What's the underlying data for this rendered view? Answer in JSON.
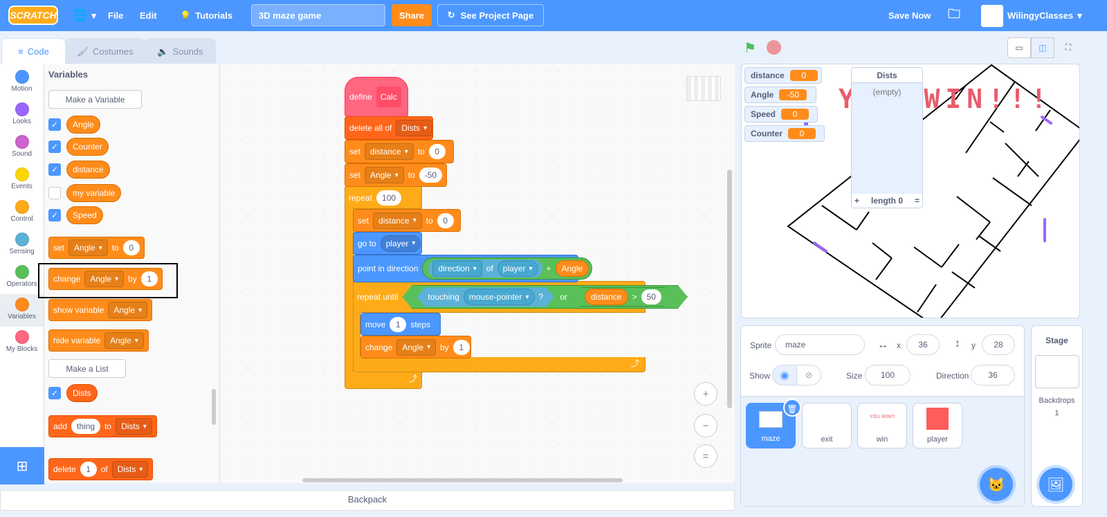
{
  "menubar": {
    "logo": "SCRATCH",
    "file": "File",
    "edit": "Edit",
    "tutorials": "Tutorials",
    "project_title": "3D maze game",
    "share": "Share",
    "see_project": "See Project Page",
    "save_now": "Save Now",
    "username": "WilingyClasses"
  },
  "tabs": {
    "code": "Code",
    "costumes": "Costumes",
    "sounds": "Sounds"
  },
  "categories": [
    {
      "label": "Motion",
      "color": "#4c97ff"
    },
    {
      "label": "Looks",
      "color": "#9966ff"
    },
    {
      "label": "Sound",
      "color": "#cf63cf"
    },
    {
      "label": "Events",
      "color": "#ffd500"
    },
    {
      "label": "Control",
      "color": "#ffab19"
    },
    {
      "label": "Sensing",
      "color": "#5cb1d6"
    },
    {
      "label": "Operators",
      "color": "#59c059"
    },
    {
      "label": "Variables",
      "color": "#ff8c1a"
    },
    {
      "label": "My Blocks",
      "color": "#ff6680"
    }
  ],
  "palette": {
    "heading": "Variables",
    "make_variable": "Make a Variable",
    "variables": [
      {
        "name": "Angle",
        "checked": true
      },
      {
        "name": "Counter",
        "checked": true
      },
      {
        "name": "distance",
        "checked": true
      },
      {
        "name": "my variable",
        "checked": false
      },
      {
        "name": "Speed",
        "checked": true
      }
    ],
    "set_block": {
      "w1": "set",
      "var": "Angle",
      "w2": "to",
      "val": "0"
    },
    "change_block": {
      "w1": "change",
      "var": "Angle",
      "w2": "by",
      "val": "1"
    },
    "show_block": {
      "w1": "show variable",
      "var": "Angle"
    },
    "hide_block": {
      "w1": "hide variable",
      "var": "Angle"
    },
    "make_list": "Make a List",
    "list": {
      "name": "Dists",
      "checked": true
    },
    "add_block": {
      "w1": "add",
      "val": "thing",
      "w2": "to",
      "list": "Dists"
    },
    "delete_block": {
      "w1": "delete",
      "val": "1",
      "w2": "of",
      "list": "Dists"
    }
  },
  "script": {
    "define": "define",
    "define_name": "Calc",
    "delete_all": "delete all of",
    "delete_list": "Dists",
    "set1": {
      "w1": "set",
      "var": "distance",
      "w2": "to",
      "val": "0"
    },
    "set2": {
      "w1": "set",
      "var": "Angle",
      "w2": "to",
      "val": "-50"
    },
    "repeat": "repeat",
    "repeat_count": "100",
    "set3": {
      "w1": "set",
      "var": "distance",
      "w2": "to",
      "val": "0"
    },
    "goto": "go to",
    "goto_target": "player",
    "point": "point in direction",
    "direction": "direction",
    "of": "of",
    "of_target": "player",
    "plus": "+",
    "angle_var": "Angle",
    "repeat_until": "repeat until",
    "touching": "touching",
    "touch_target": "mouse-pointer",
    "question": "?",
    "or": "or",
    "dist_var": "distance",
    "gt": ">",
    "gt_val": "50",
    "move": "move",
    "move_val": "1",
    "steps": "steps",
    "change": {
      "w1": "change",
      "var": "Angle",
      "w2": "by",
      "val": "1"
    }
  },
  "zoom": {
    "in": "+",
    "out": "−",
    "reset": "="
  },
  "backpack": "Backpack",
  "monitors": [
    {
      "name": "distance",
      "value": "0"
    },
    {
      "name": "Angle",
      "value": "-50"
    },
    {
      "name": "Speed",
      "value": "0"
    },
    {
      "name": "Counter",
      "value": "0"
    }
  ],
  "list_monitor": {
    "title": "Dists",
    "empty": "(empty)",
    "add": "+",
    "length": "length 0",
    "resize": "="
  },
  "stage_text": "YOU WIN!!!",
  "sprite_info": {
    "sprite_label": "Sprite",
    "sprite_name": "maze",
    "x_label": "x",
    "x": "36",
    "y_label": "y",
    "y": "28",
    "show_label": "Show",
    "size_label": "Size",
    "size": "100",
    "direction_label": "Direction",
    "direction": "36"
  },
  "sprites": [
    {
      "name": "maze",
      "selected": true
    },
    {
      "name": "exit"
    },
    {
      "name": "win",
      "thumb_text": "YOU WIN!!!"
    },
    {
      "name": "player",
      "color": "#ff5c5c"
    }
  ],
  "stage_pane": {
    "title": "Stage",
    "backdrops_label": "Backdrops",
    "backdrops_count": "1"
  }
}
